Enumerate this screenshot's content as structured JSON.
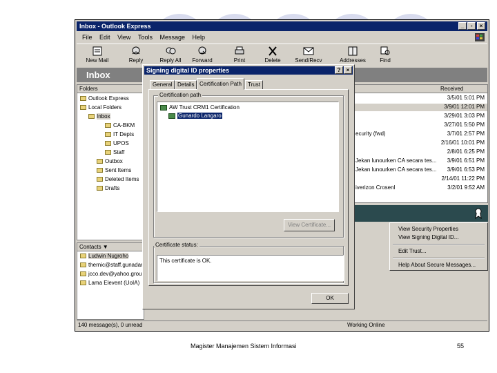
{
  "window": {
    "title": "Inbox - Outlook Express",
    "min": "_",
    "max": "▫",
    "close": "×"
  },
  "menu": [
    "File",
    "Edit",
    "View",
    "Tools",
    "Message",
    "Help"
  ],
  "toolbar": [
    {
      "label": "New Mail",
      "icon": "new-mail-icon"
    },
    {
      "label": "Reply",
      "icon": "reply-icon"
    },
    {
      "label": "Reply All",
      "icon": "reply-all-icon"
    },
    {
      "label": "Forward",
      "icon": "forward-icon"
    },
    {
      "label": "Print",
      "icon": "print-icon"
    },
    {
      "label": "Delete",
      "icon": "delete-icon"
    },
    {
      "label": "Send/Recv",
      "icon": "send-recv-icon"
    },
    {
      "label": "Addresses",
      "icon": "addresses-icon"
    },
    {
      "label": "Find",
      "icon": "find-icon"
    }
  ],
  "banner": "Inbox",
  "folders": {
    "header": "Folders",
    "items": [
      "Outlook Express",
      "Local Folders",
      "Inbox",
      "CA-BKM",
      "IT Depts",
      "UPOS",
      "Staff",
      "Outbox",
      "Sent Items",
      "Deleted Items",
      "Drafts"
    ]
  },
  "contacts": {
    "header": "Contacts ▼",
    "items": [
      "Ludwin Nugroho",
      "thernic@staff.gunadar",
      "jcco.dev@yahoo.group",
      "Lama Elevent (UoIA)"
    ]
  },
  "messages": {
    "received_header": "Received",
    "dates": [
      "3/5/01 5:01 PM",
      "3/9/01 12:01 PM",
      "3/29/01 3:03 PM",
      "3/27/01 5:50 PM",
      "3/7/01 2:57 PM",
      "2/16/01 10:01 PM",
      "2/8/01 6:25 PM",
      "3/9/01 6:51 PM",
      "3/9/01 6:53 PM",
      "2/14/01 11:22 PM",
      "3/2/01 9:52 AM"
    ],
    "subjects": [
      "",
      "",
      "",
      "",
      "ecurity (fwd)",
      "",
      "",
      "Jekan lunourken CA secara tes...",
      "Jekan lunourken CA secara tes...",
      "",
      "iverizon Crosenl"
    ]
  },
  "context_menu": [
    "View Security Properties",
    "View Signing Digital ID...",
    "Edit Trust...",
    "Help About Secure Messages..."
  ],
  "status": {
    "left": "140 message(s), 0 unread",
    "right": "Working Online"
  },
  "dialog": {
    "title": "Signing digital ID properties",
    "help": "?",
    "close": "×",
    "tabs": [
      "General",
      "Details",
      "Certification Path",
      "Trust"
    ],
    "path_label": "Certification path",
    "path_items": [
      "AW Trust CRM1 Certification",
      "Gunardo Langaro"
    ],
    "view_cert_button": "View Certificate...",
    "status_label": "Certificate status:",
    "status_text": "This certificate is OK.",
    "ok_button": "OK"
  },
  "footer": {
    "caption": "Magister Manajemen Sistem Informasi",
    "page": "55"
  }
}
